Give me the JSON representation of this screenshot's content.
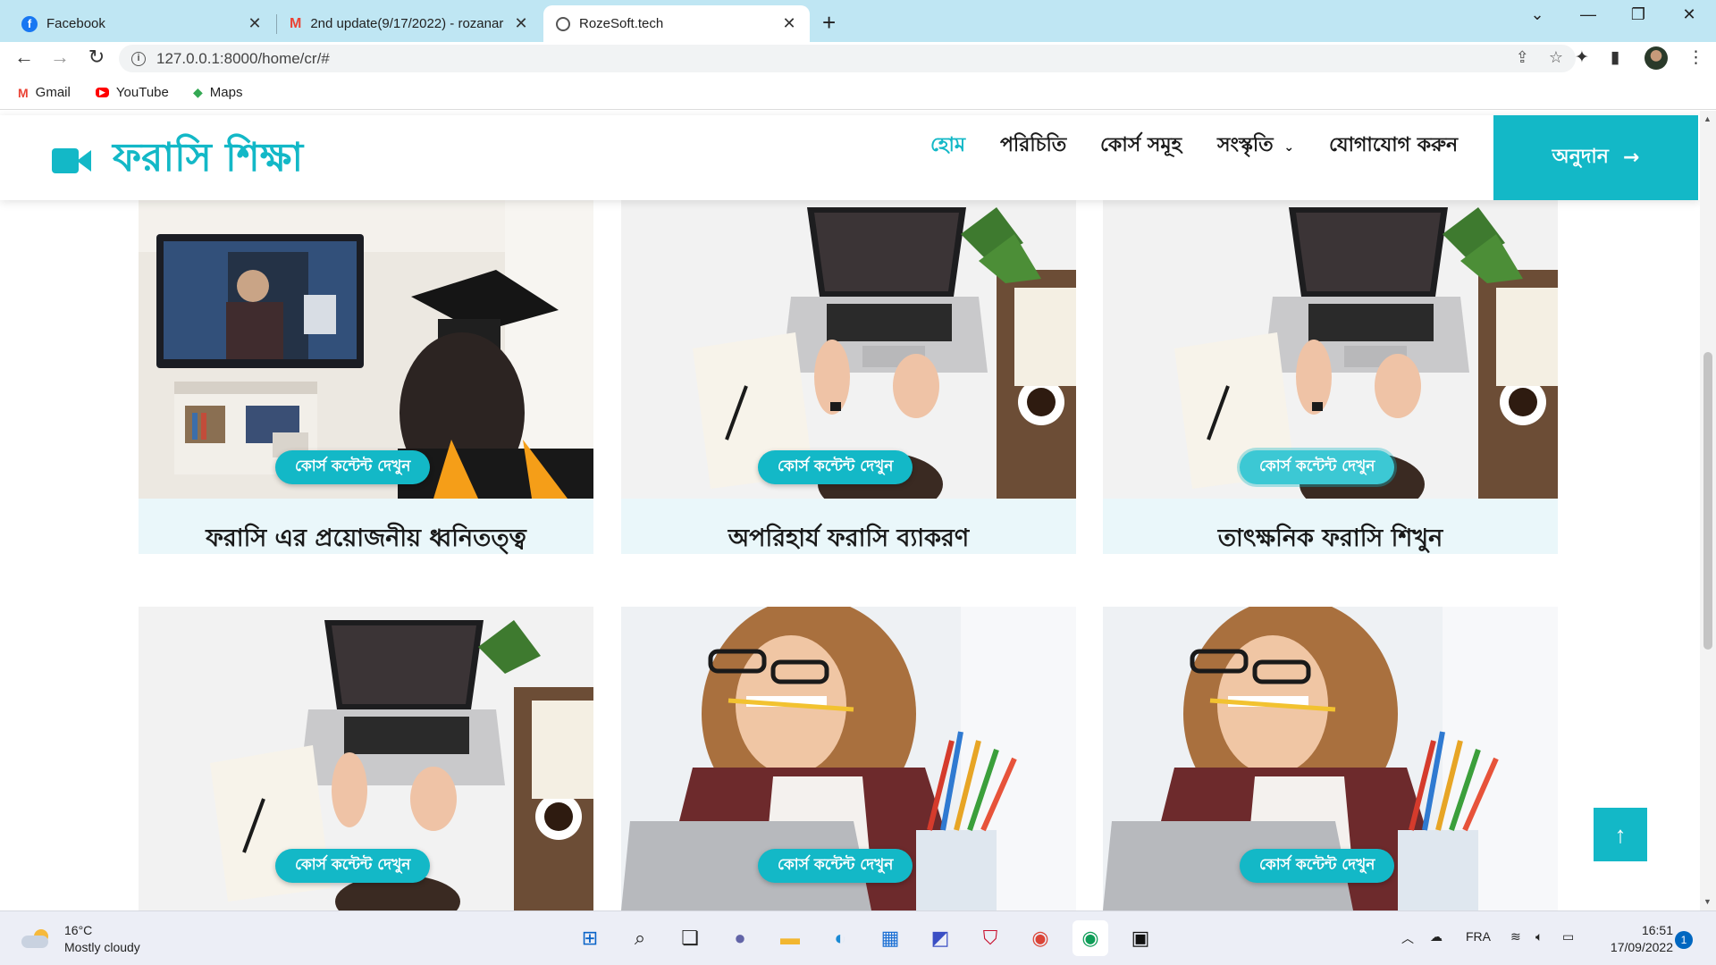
{
  "browser": {
    "tabs": [
      {
        "title": "Facebook",
        "icon": "facebook-icon",
        "active": false
      },
      {
        "title": "2nd update(9/17/2022) - rozanar",
        "icon": "gmail-icon",
        "active": false
      },
      {
        "title": "RozeSoft.tech",
        "icon": "globe-icon",
        "active": true
      }
    ],
    "url": "127.0.0.1:8000/home/cr/#",
    "bookmarks": [
      {
        "label": "Gmail",
        "icon": "gmail-icon",
        "color": "#ea4335"
      },
      {
        "label": "YouTube",
        "icon": "youtube-icon",
        "color": "#ff0000"
      },
      {
        "label": "Maps",
        "icon": "maps-icon",
        "color": "#34a853"
      }
    ]
  },
  "site": {
    "logo": "ফরাসি শিক্ষা",
    "accent": "#13b8c7",
    "menu": [
      {
        "label": "হোম",
        "active": true
      },
      {
        "label": "পরিচিতি",
        "active": false
      },
      {
        "label": "কোর্স সমূহ",
        "active": false
      },
      {
        "label": "সংস্কৃতি",
        "active": false,
        "dropdown": true
      },
      {
        "label": "যোগাযোগ করুন",
        "active": false
      }
    ],
    "donate": "অনুদান"
  },
  "courses": [
    {
      "title": "ফরাসি এর প্রয়োজনীয় ধ্বনিতত্ত্ব",
      "button": "কোর্স কন্টেন্ট দেখুন",
      "image": "graduate-watching-tv"
    },
    {
      "title": "অপরিহার্য ফরাসি ব্যাকরণ",
      "button": "কোর্স কন্টেন্ট দেখুন",
      "image": "desk-with-laptop"
    },
    {
      "title": "তাৎক্ষনিক ফরাসি শিখুন",
      "button": "কোর্স কন্টেন্ট দেখুন",
      "image": "desk-with-laptop"
    },
    {
      "title": "",
      "button": "কোর্স কন্টেন্ট দেখুন",
      "image": "desk-with-laptop"
    },
    {
      "title": "",
      "button": "কোর্স কন্টেন্ট দেখুন",
      "image": "student-biting-pencil"
    },
    {
      "title": "",
      "button": "কোর্স কন্টেন্ট দেখুন",
      "image": "student-biting-pencil"
    }
  ],
  "taskbar": {
    "weather_temp": "16°C",
    "weather_desc": "Mostly cloudy",
    "language": "FRA",
    "time": "16:51",
    "date": "17/09/2022",
    "notifications": "1"
  }
}
